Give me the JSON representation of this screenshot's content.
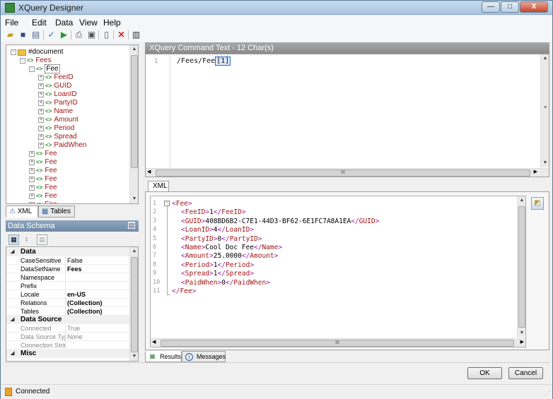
{
  "window": {
    "title": "XQuery Designer",
    "min": "—",
    "max": "□",
    "close": "X"
  },
  "menu": [
    "File",
    "Edit",
    "Data",
    "View",
    "Help"
  ],
  "toolbar_icons": [
    "open-icon",
    "save-icon",
    "properties-icon",
    "check-icon",
    "run-icon",
    "print-icon",
    "print-preview-icon",
    "page-icon",
    "delete-icon",
    "columns-icon"
  ],
  "tree": {
    "root": "#document",
    "nodes": [
      {
        "label": "Fees",
        "exp": "-"
      },
      {
        "label": "Fee",
        "exp": "-",
        "selected": true
      },
      {
        "label": "FeeID",
        "exp": "+"
      },
      {
        "label": "GUID",
        "exp": "+"
      },
      {
        "label": "LoanID",
        "exp": "+"
      },
      {
        "label": "PartyID",
        "exp": "+"
      },
      {
        "label": "Name",
        "exp": "+"
      },
      {
        "label": "Amount",
        "exp": "+"
      },
      {
        "label": "Period",
        "exp": "+"
      },
      {
        "label": "Spread",
        "exp": "+"
      },
      {
        "label": "PaidWhen",
        "exp": "+"
      },
      {
        "label": "Fee",
        "exp": "+"
      },
      {
        "label": "Fee",
        "exp": "+"
      },
      {
        "label": "Fee",
        "exp": "+"
      },
      {
        "label": "Fee",
        "exp": "+"
      },
      {
        "label": "Fee",
        "exp": "+"
      },
      {
        "label": "Fee",
        "exp": "+"
      },
      {
        "label": "Fee",
        "exp": "+"
      }
    ]
  },
  "left_tabs": {
    "xml": "XML",
    "tables": "Tables"
  },
  "schema": {
    "title": "Data Schema",
    "categories": [
      {
        "name": "Data",
        "rows": [
          {
            "name": "CaseSensitive",
            "value": "False",
            "bold": false
          },
          {
            "name": "DataSetName",
            "value": "Fees",
            "bold": true
          },
          {
            "name": "Namespace",
            "value": "",
            "bold": false
          },
          {
            "name": "Prefix",
            "value": "",
            "bold": false
          },
          {
            "name": "Locale",
            "value": "en-US",
            "bold": true
          },
          {
            "name": "Relations",
            "value": "(Collection)",
            "bold": true
          },
          {
            "name": "Tables",
            "value": "(Collection)",
            "bold": true
          }
        ]
      },
      {
        "name": "Data Source",
        "rows": [
          {
            "name": "Connected",
            "value": "True",
            "bold": false,
            "disabled": true
          },
          {
            "name": "Data Source Type",
            "value": "None",
            "bold": false,
            "disabled": true
          },
          {
            "name": "Connection String",
            "value": "",
            "bold": false,
            "disabled": true
          }
        ]
      },
      {
        "name": "Misc",
        "rows": []
      }
    ]
  },
  "command": {
    "header": "XQuery Command Text - 12 Char(s)",
    "line_no": "1",
    "text_before": "/Fees/Fee",
    "text_cursor": "[1]"
  },
  "xml_tab": "XML",
  "xml_lines": [
    {
      "n": "1",
      "indent": 0,
      "open": "Fee",
      "text": "",
      "close": ""
    },
    {
      "n": "2",
      "indent": 1,
      "open": "FeeID",
      "text": "1",
      "close": "FeeID"
    },
    {
      "n": "3",
      "indent": 1,
      "open": "GUID",
      "text": "408BD6B2-C7E1-44D3-BF62-6E1FC7A8A1EA",
      "close": "GUID"
    },
    {
      "n": "4",
      "indent": 1,
      "open": "LoanID",
      "text": "4",
      "close": "LoanID"
    },
    {
      "n": "5",
      "indent": 1,
      "open": "PartyID",
      "text": "0",
      "close": "PartyID"
    },
    {
      "n": "6",
      "indent": 1,
      "open": "Name",
      "text": "Cool Doc Fee",
      "close": "Name"
    },
    {
      "n": "7",
      "indent": 1,
      "open": "Amount",
      "text": "25.0000",
      "close": "Amount"
    },
    {
      "n": "8",
      "indent": 1,
      "open": "Period",
      "text": "1",
      "close": "Period"
    },
    {
      "n": "9",
      "indent": 1,
      "open": "Spread",
      "text": "1",
      "close": "Spread"
    },
    {
      "n": "10",
      "indent": 1,
      "open": "PaidWhen",
      "text": "0",
      "close": "PaidWhen"
    },
    {
      "n": "11",
      "indent": 0,
      "open": "",
      "text": "",
      "close": "Fee"
    }
  ],
  "bottom_tabs": {
    "results": "Results",
    "messages": "Messages"
  },
  "buttons": {
    "ok": "OK",
    "cancel": "Cancel"
  },
  "status": "Connected",
  "scroll_mark": "III"
}
